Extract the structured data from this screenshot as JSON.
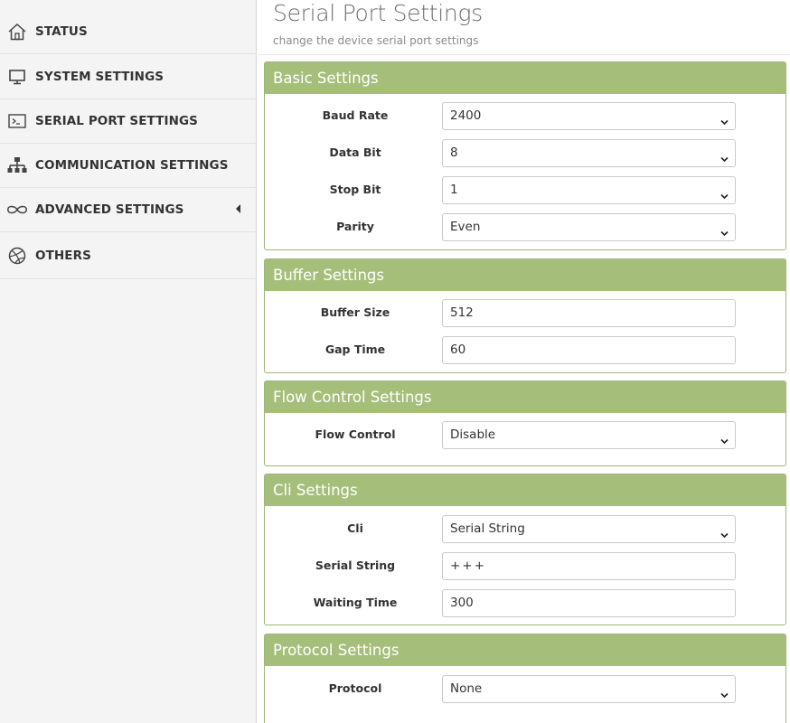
{
  "sidebar": {
    "items": [
      {
        "label": "STATUS",
        "icon": "home-icon"
      },
      {
        "label": "SYSTEM SETTINGS",
        "icon": "monitor-icon"
      },
      {
        "label": "SERIAL PORT SETTINGS",
        "icon": "terminal-icon"
      },
      {
        "label": "COMMUNICATION SETTINGS",
        "icon": "network-icon"
      },
      {
        "label": "ADVANCED SETTINGS",
        "icon": "infinity-icon"
      },
      {
        "label": "OTHERS",
        "icon": "dribbble-icon"
      }
    ]
  },
  "header": {
    "title": "Serial Port Settings",
    "subtitle": "change the device serial port settings"
  },
  "panels": {
    "basic": {
      "title": "Basic Settings",
      "baud_rate": {
        "label": "Baud Rate",
        "value": "2400"
      },
      "data_bit": {
        "label": "Data Bit",
        "value": "8"
      },
      "stop_bit": {
        "label": "Stop Bit",
        "value": "1"
      },
      "parity": {
        "label": "Parity",
        "value": "Even"
      }
    },
    "buffer": {
      "title": "Buffer Settings",
      "buffer_size": {
        "label": "Buffer Size",
        "value": "512"
      },
      "gap_time": {
        "label": "Gap Time",
        "value": "60"
      }
    },
    "flow": {
      "title": "Flow Control Settings",
      "flow_control": {
        "label": "Flow Control",
        "value": "Disable"
      }
    },
    "cli": {
      "title": "Cli Settings",
      "cli": {
        "label": "Cli",
        "value": "Serial String"
      },
      "serial_string": {
        "label": "Serial String",
        "value": "+++"
      },
      "waiting_time": {
        "label": "Waiting Time",
        "value": "300"
      }
    },
    "protocol": {
      "title": "Protocol Settings",
      "protocol": {
        "label": "Protocol",
        "value": "None"
      }
    }
  },
  "colors": {
    "panel_header": "#a5bf7b",
    "panel_border": "#9cb877",
    "sidebar_bg": "#f4f4f4"
  }
}
